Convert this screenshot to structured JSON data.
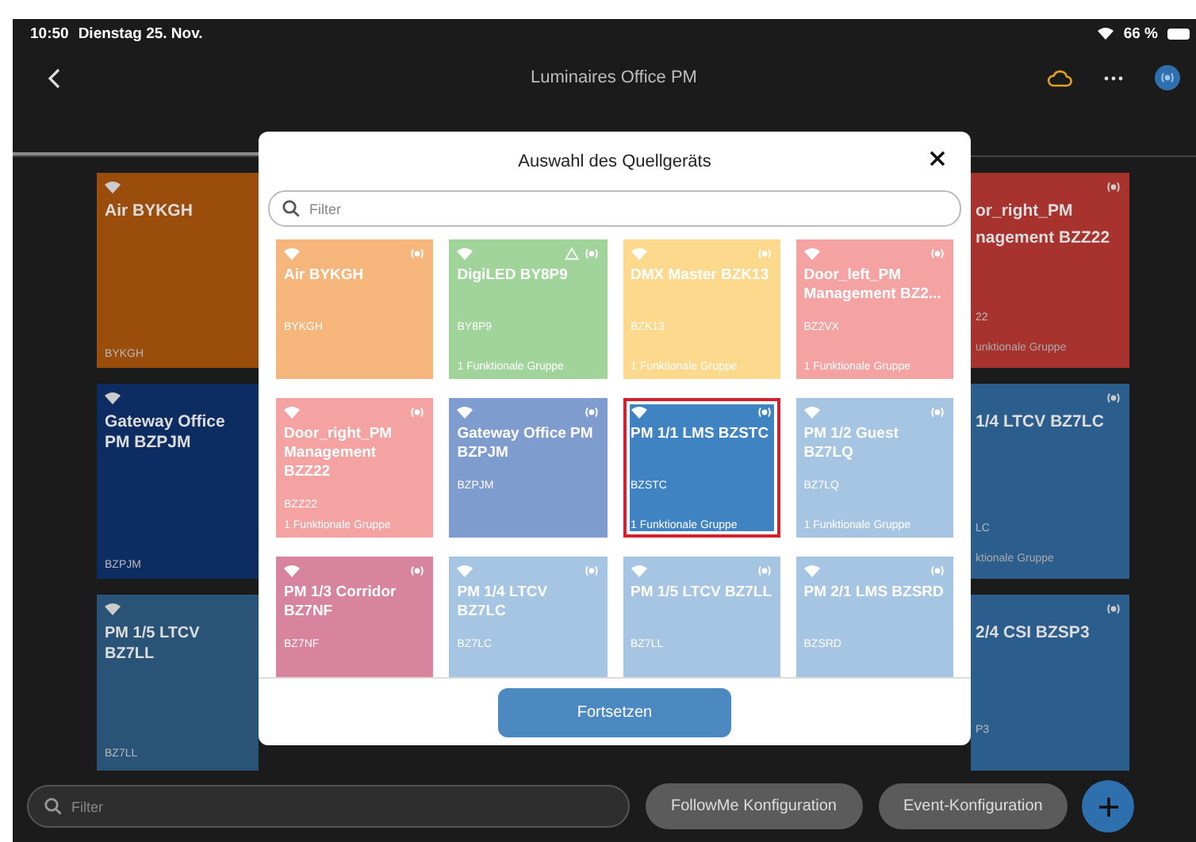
{
  "status_bar": {
    "time": "10:50",
    "date": "Dienstag 25. Nov.",
    "battery": "66 %"
  },
  "header": {
    "title": "Luminaires Office PM"
  },
  "tabs": [
    {
      "selected": true
    },
    {
      "selected": false
    }
  ],
  "background": {
    "left_cards": [
      {
        "title": "Air BYKGH",
        "id": "BYKGH",
        "color": "#9b4d0c"
      },
      {
        "title": "Gateway Office PM BZPJM",
        "id": "BZPJM",
        "color": "#0d2c62"
      },
      {
        "title": "PM 1/5 LTCV BZ7LL",
        "id": "BZ7LL",
        "color": "#2a5378"
      }
    ],
    "right_cards": [
      {
        "title_lines": [
          "or_right_PM",
          "nagement BZZ22"
        ],
        "id": "22",
        "group": "unktionale Gruppe",
        "color": "#a8322e"
      },
      {
        "title_lines": [
          "1/4 LTCV BZ7LC"
        ],
        "id": "LC",
        "group": "ktionale Gruppe",
        "color": "#2c5e8d"
      },
      {
        "title_lines": [
          "2/4 CSI BZSP3"
        ],
        "id": "P3",
        "color": "#2c5e8d"
      }
    ]
  },
  "dialog": {
    "title": "Auswahl des Quellgeräts",
    "filter_placeholder": "Filter",
    "tiles": [
      {
        "title": "Air BYKGH",
        "id": "BYKGH",
        "color": "#f6b57b",
        "alert": false,
        "selected": false
      },
      {
        "title": "DigiLED BY8P9",
        "id": "BY8P9",
        "group": "1 Funktionale Gruppe",
        "color": "#a0d49b",
        "alert": true,
        "selected": false
      },
      {
        "title": "DMX Master BZK13",
        "id": "BZK13",
        "group": "1 Funktionale Gruppe",
        "color": "#fcd98c",
        "alert": false,
        "selected": false
      },
      {
        "title": "Door_left_PM Management BZ2...",
        "id": "BZ2VX",
        "group": "1 Funktionale Gruppe",
        "color": "#f4a2a2",
        "alert": false,
        "selected": false
      },
      {
        "title": "Door_right_PM Management BZZ22",
        "id": "BZZ22",
        "group": "1 Funktionale Gruppe",
        "color": "#f4a2a2",
        "alert": false,
        "selected": false
      },
      {
        "title": "Gateway Office PM BZPJM",
        "id": "BZPJM",
        "color": "#7f9ccf",
        "alert": false,
        "selected": false
      },
      {
        "title": "PM 1/1  LMS BZSTC",
        "id": "BZSTC",
        "group": "1 Funktionale Gruppe",
        "color": "#3f83c3",
        "alert": false,
        "selected": true
      },
      {
        "title": "PM 1/2 Guest BZ7LQ",
        "id": "BZ7LQ",
        "group": "1 Funktionale Gruppe",
        "color": "#a5c5e2",
        "alert": false,
        "selected": false
      },
      {
        "title": "PM 1/3 Corridor BZ7NF",
        "id": "BZ7NF",
        "color": "#d8849e",
        "alert": false,
        "selected": false
      },
      {
        "title": "PM 1/4 LTCV BZ7LC",
        "id": "BZ7LC",
        "color": "#a5c5e2",
        "alert": false,
        "selected": false
      },
      {
        "title": "PM 1/5 LTCV BZ7LL",
        "id": "BZ7LL",
        "color": "#a5c5e2",
        "alert": false,
        "selected": false
      },
      {
        "title": "PM 2/1 LMS BZSRD",
        "id": "BZSRD",
        "color": "#a5c5e2",
        "alert": false,
        "selected": false
      }
    ],
    "button": "Fortsetzen"
  },
  "bottom_bar": {
    "filter_placeholder": "Filter",
    "buttons": [
      "FollowMe Konfiguration",
      "Event-Konfiguration"
    ]
  }
}
